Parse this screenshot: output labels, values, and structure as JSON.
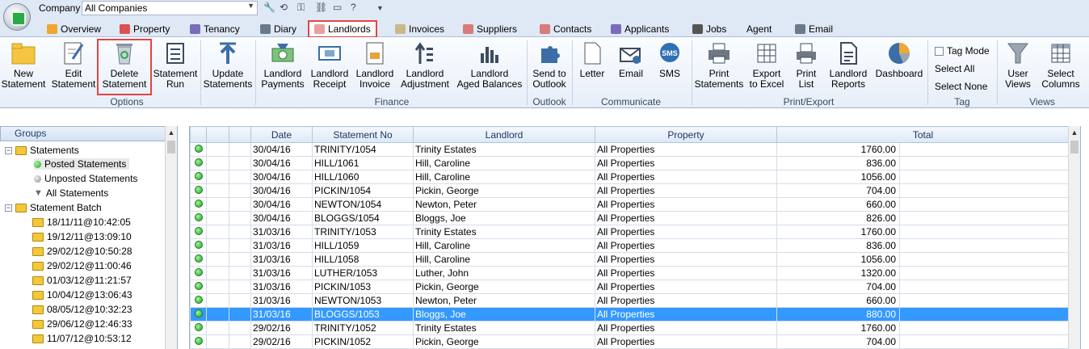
{
  "topbar": {
    "company_label": "Company",
    "company_value": "All Companies"
  },
  "tabs": [
    {
      "label": "Overview"
    },
    {
      "label": "Property"
    },
    {
      "label": "Tenancy"
    },
    {
      "label": "Diary"
    },
    {
      "label": "Landlords"
    },
    {
      "label": "Invoices"
    },
    {
      "label": "Suppliers"
    },
    {
      "label": "Contacts"
    },
    {
      "label": "Applicants"
    },
    {
      "label": "Jobs"
    },
    {
      "label": "Agent"
    },
    {
      "label": "Email"
    }
  ],
  "ribbon": {
    "buttons": [
      {
        "label": "New\nStatement"
      },
      {
        "label": "Edit\nStatement"
      },
      {
        "label": "Delete\nStatement"
      },
      {
        "label": "Statement\nRun"
      },
      {
        "label": "Update\nStatements"
      },
      {
        "label": "Landlord\nPayments"
      },
      {
        "label": "Landlord\nReceipt"
      },
      {
        "label": "Landlord\nInvoice"
      },
      {
        "label": "Landlord\nAdjustment"
      },
      {
        "label": "Landlord\nAged Balances"
      },
      {
        "label": "Send to\nOutlook"
      },
      {
        "label": "Letter"
      },
      {
        "label": "Email"
      },
      {
        "label": "SMS"
      },
      {
        "label": "Print\nStatements"
      },
      {
        "label": "Export\nto Excel"
      },
      {
        "label": "Print\nList"
      },
      {
        "label": "Landlord\nReports"
      },
      {
        "label": "Dashboard"
      },
      {
        "label": "User\nViews"
      },
      {
        "label": "Select\nColumns"
      }
    ],
    "tag": {
      "tag_mode": "Tag Mode",
      "select_all": "Select All",
      "select_none": "Select None"
    },
    "groups": {
      "options": "Options",
      "finance": "Finance",
      "outlook": "Outlook",
      "communicate": "Communicate",
      "print_export": "Print/Export",
      "tag": "Tag",
      "views": "Views"
    }
  },
  "groups_panel": {
    "title": "Groups",
    "statements": "Statements",
    "posted": "Posted Statements",
    "unposted": "Unposted Statements",
    "all": "All Statements",
    "batch": "Statement Batch",
    "batches": [
      "18/11/11@10:42:05",
      "19/12/11@13:09:10",
      "29/02/12@10:50:28",
      "29/02/12@11:00:46",
      "01/03/12@11:21:57",
      "10/04/12@13:06:43",
      "08/05/12@10:32:23",
      "29/06/12@12:46:33",
      "11/07/12@10:53:12"
    ]
  },
  "grid": {
    "headers": {
      "date": "Date",
      "statement_no": "Statement No",
      "landlord": "Landlord",
      "property": "Property",
      "total": "Total"
    },
    "selected_index": 12,
    "rows": [
      [
        "30/04/16",
        "TRINITY/1054",
        "Trinity Estates",
        "All Properties",
        "1760.00"
      ],
      [
        "30/04/16",
        "HILL/1061",
        "Hill, Caroline",
        "All Properties",
        "836.00"
      ],
      [
        "30/04/16",
        "HILL/1060",
        "Hill, Caroline",
        "All Properties",
        "1056.00"
      ],
      [
        "30/04/16",
        "PICKIN/1054",
        "Pickin, George",
        "All Properties",
        "704.00"
      ],
      [
        "30/04/16",
        "NEWTON/1054",
        "Newton, Peter",
        "All Properties",
        "660.00"
      ],
      [
        "30/04/16",
        "BLOGGS/1054",
        "Bloggs, Joe",
        "All Properties",
        "826.00"
      ],
      [
        "31/03/16",
        "TRINITY/1053",
        "Trinity Estates",
        "All Properties",
        "1760.00"
      ],
      [
        "31/03/16",
        "HILL/1059",
        "Hill, Caroline",
        "All Properties",
        "836.00"
      ],
      [
        "31/03/16",
        "HILL/1058",
        "Hill, Caroline",
        "All Properties",
        "1056.00"
      ],
      [
        "31/03/16",
        "LUTHER/1053",
        "Luther, John",
        "All Properties",
        "1320.00"
      ],
      [
        "31/03/16",
        "PICKIN/1053",
        "Pickin, George",
        "All Properties",
        "704.00"
      ],
      [
        "31/03/16",
        "NEWTON/1053",
        "Newton, Peter",
        "All Properties",
        "660.00"
      ],
      [
        "31/03/16",
        "BLOGGS/1053",
        "Bloggs, Joe",
        "All Properties",
        "880.00"
      ],
      [
        "29/02/16",
        "TRINITY/1052",
        "Trinity Estates",
        "All Properties",
        "1760.00"
      ],
      [
        "29/02/16",
        "PICKIN/1052",
        "Pickin, George",
        "All Properties",
        "704.00"
      ]
    ]
  }
}
